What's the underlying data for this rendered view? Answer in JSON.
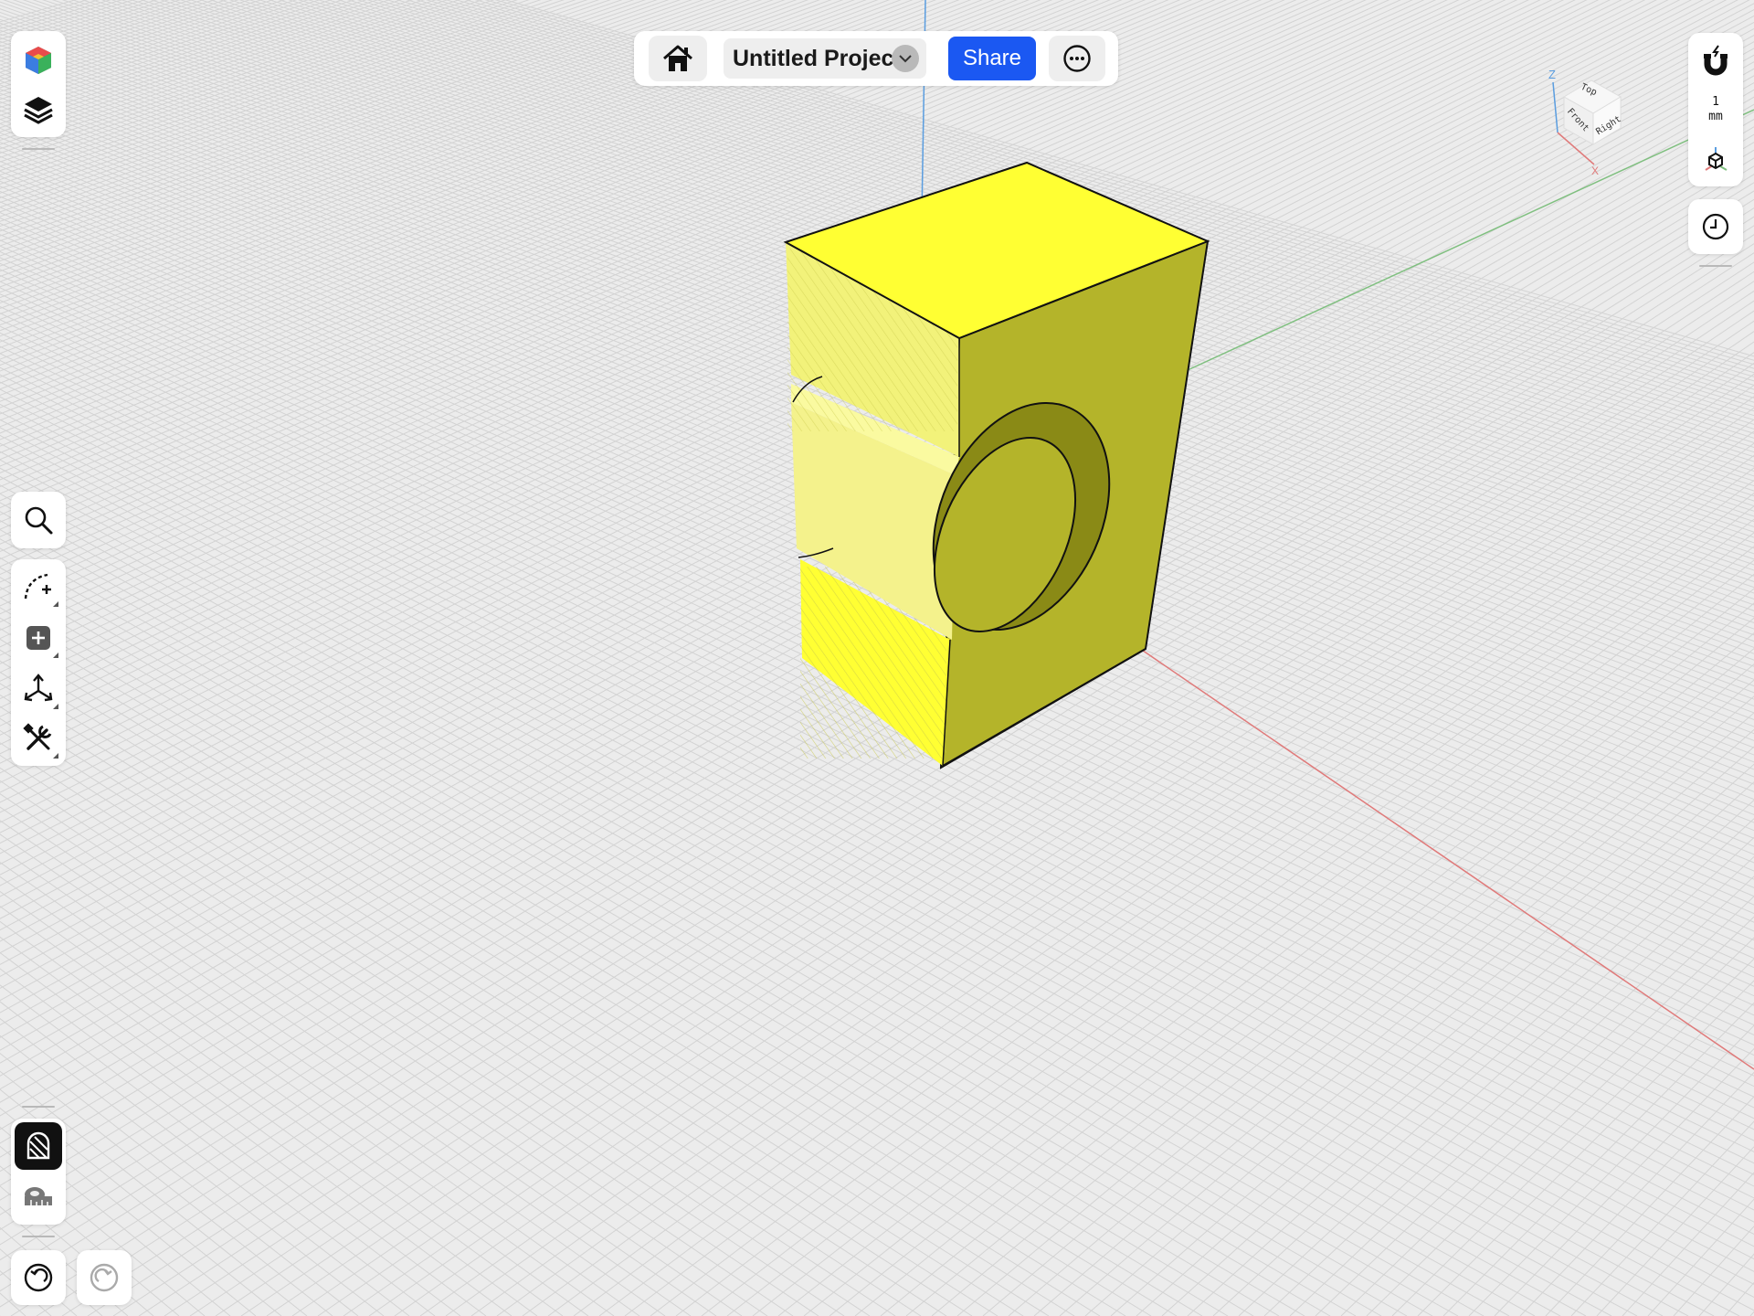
{
  "header": {
    "project_title": "Untitled Project",
    "share_label": "Share"
  },
  "right_toolbar": {
    "grid_value": "1",
    "grid_unit": "mm"
  },
  "view_cube": {
    "top": "Top",
    "front": "Front",
    "right": "Right",
    "axis_z": "Z",
    "axis_x": "X"
  },
  "icons": {
    "home": "home-icon",
    "more": "more-options-icon",
    "dropdown": "chevron-down-icon",
    "app_logo": "app-logo-icon",
    "layers": "layers-icon",
    "search": "search-icon",
    "sketch": "sketch-icon",
    "add": "add-icon",
    "transform": "transform-icon",
    "tools": "tools-icon",
    "render": "render-mode-icon",
    "measure": "measure-tape-icon",
    "undo": "undo-icon",
    "redo": "redo-icon",
    "snap": "snap-magnet-icon",
    "axes": "axes-icon",
    "history": "history-icon"
  },
  "colors": {
    "accent": "#1b58f2",
    "model_yellow": "#ffff33",
    "axis_x": "#e07a7a",
    "axis_y": "#7fbf7f",
    "axis_z": "#5a9de0"
  }
}
